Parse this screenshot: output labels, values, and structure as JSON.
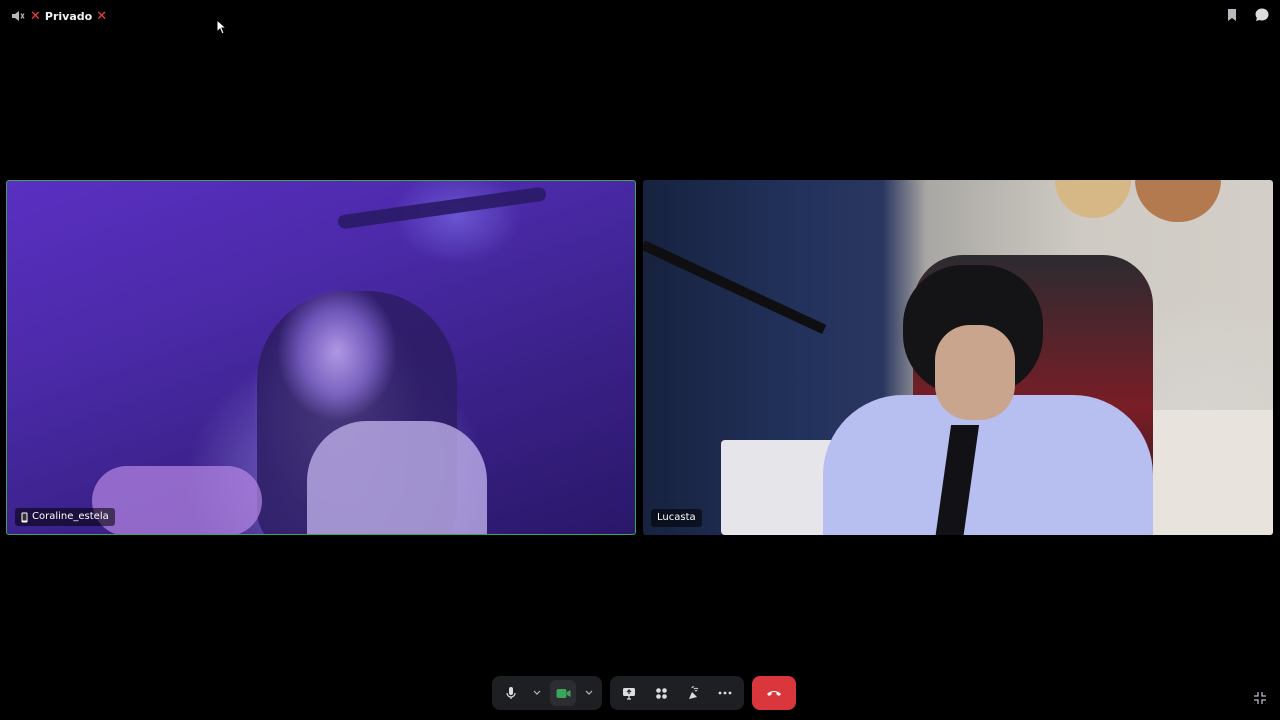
{
  "topbar": {
    "channel_title": "Privado"
  },
  "participants": [
    {
      "name": "Coraline_estela",
      "device": "mobile-phone-icon",
      "speaking": true
    },
    {
      "name": "Lucasta",
      "speaking": false
    }
  ],
  "colors": {
    "speaking_border": "#3ba55c",
    "end_call": "#da373c",
    "status_red": "#f23f43",
    "camera_on": "#3ba55c"
  },
  "controls": {
    "microphone": "microphone-icon",
    "microphone_options": "chevron-down-icon",
    "camera": "video-camera-icon",
    "camera_options": "chevron-down-icon",
    "screen_share": "screen-share-icon",
    "activities": "activities-icon",
    "soundboard": "soundboard-icon",
    "more": "more-options-icon",
    "disconnect": "hang-up-icon",
    "exit_fullscreen": "exit-fullscreen-icon"
  }
}
